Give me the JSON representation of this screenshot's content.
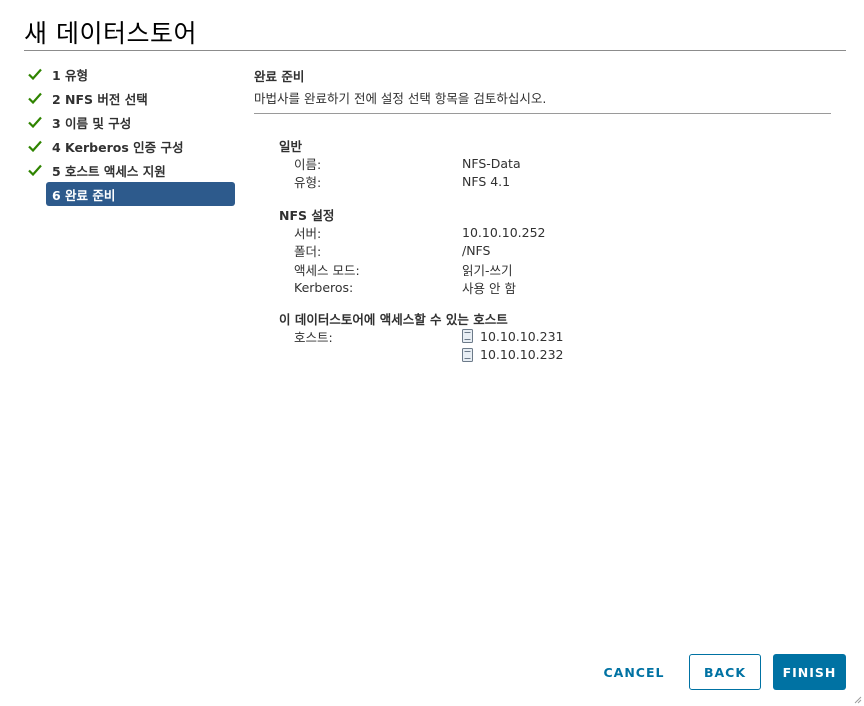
{
  "dialog": {
    "title": "새 데이터스토어"
  },
  "steps": [
    {
      "label": "1 유형",
      "completed": true
    },
    {
      "label": "2 NFS 버전 선택",
      "completed": true
    },
    {
      "label": "3 이름 및 구성",
      "completed": true
    },
    {
      "label": "4 Kerberos 인증 구성",
      "completed": true
    },
    {
      "label": "5 호스트 액세스 지원",
      "completed": true
    },
    {
      "label": "6 완료 준비",
      "completed": false,
      "active": true
    }
  ],
  "review": {
    "heading": "완료 준비",
    "description": "마법사를 완료하기 전에 설정 선택 항목을 검토하십시오.",
    "general": {
      "title": "일반",
      "name_label": "이름:",
      "name_value": "NFS-Data",
      "type_label": "유형:",
      "type_value": "NFS 4.1"
    },
    "nfs": {
      "title": "NFS 설정",
      "server_label": "서버:",
      "server_value": "10.10.10.252",
      "folder_label": "폴더:",
      "folder_value": "/NFS",
      "access_label": "액세스 모드:",
      "access_value": "읽기-쓰기",
      "kerberos_label": "Kerberos:",
      "kerberos_value": "사용 안 함"
    },
    "hosts": {
      "title": "이 데이터스토어에 액세스할 수 있는 호스트",
      "label": "호스트:",
      "items": [
        "10.10.10.231",
        "10.10.10.232"
      ],
      "icon": "host-server-icon"
    }
  },
  "buttons": {
    "cancel": "CANCEL",
    "back": "BACK",
    "finish": "FINISH"
  },
  "colors": {
    "accent": "#0072a3",
    "active_step": "#2d5a8c",
    "check": "#2f8400"
  }
}
